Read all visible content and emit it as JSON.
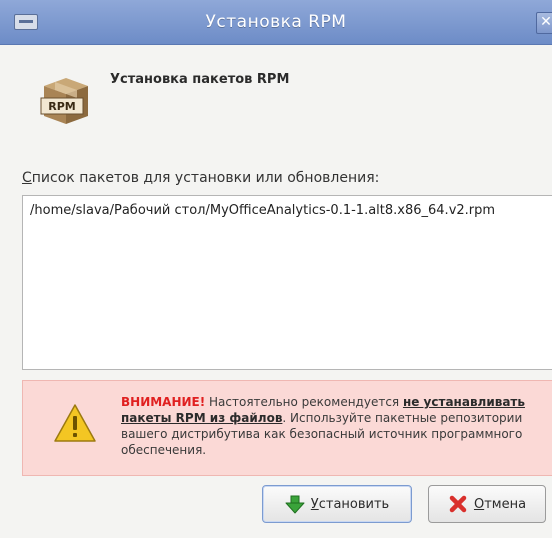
{
  "window": {
    "title": "Установка RPM",
    "close_glyph": "✕"
  },
  "header": {
    "icon": "rpm-package-icon",
    "icon_label": "RPM",
    "text": "Установка пакетов RPM"
  },
  "list": {
    "label_mnemonic": "С",
    "label_rest": "писок пакетов для установки или обновления:",
    "items": [
      "/home/slava/Рабочий стол/MyOfficeAnalytics-0.1-1.alt8.x86_64.v2.rpm"
    ]
  },
  "warning": {
    "icon": "warning-triangle-icon",
    "lead": "ВНИМАНИЕ!",
    "text1": " Настоятельно рекомендуется ",
    "strong": "не устанавливать пакеты RPM из файлов",
    "text2": ". Используйте пакетные репозитории вашего дистрибутива как безопасный источник программного обеспечения."
  },
  "buttons": {
    "install": {
      "mnemonic": "У",
      "rest": "становить",
      "icon": "install-arrow-icon"
    },
    "cancel": {
      "mnemonic": "О",
      "rest": "тмена",
      "icon": "cancel-x-icon"
    }
  },
  "colors": {
    "titlebar": "#7d99d0",
    "warning_bg": "#fbd9d6",
    "warning_lead": "#e02020",
    "install_icon": "#3aa33a",
    "cancel_icon": "#d9302c"
  }
}
